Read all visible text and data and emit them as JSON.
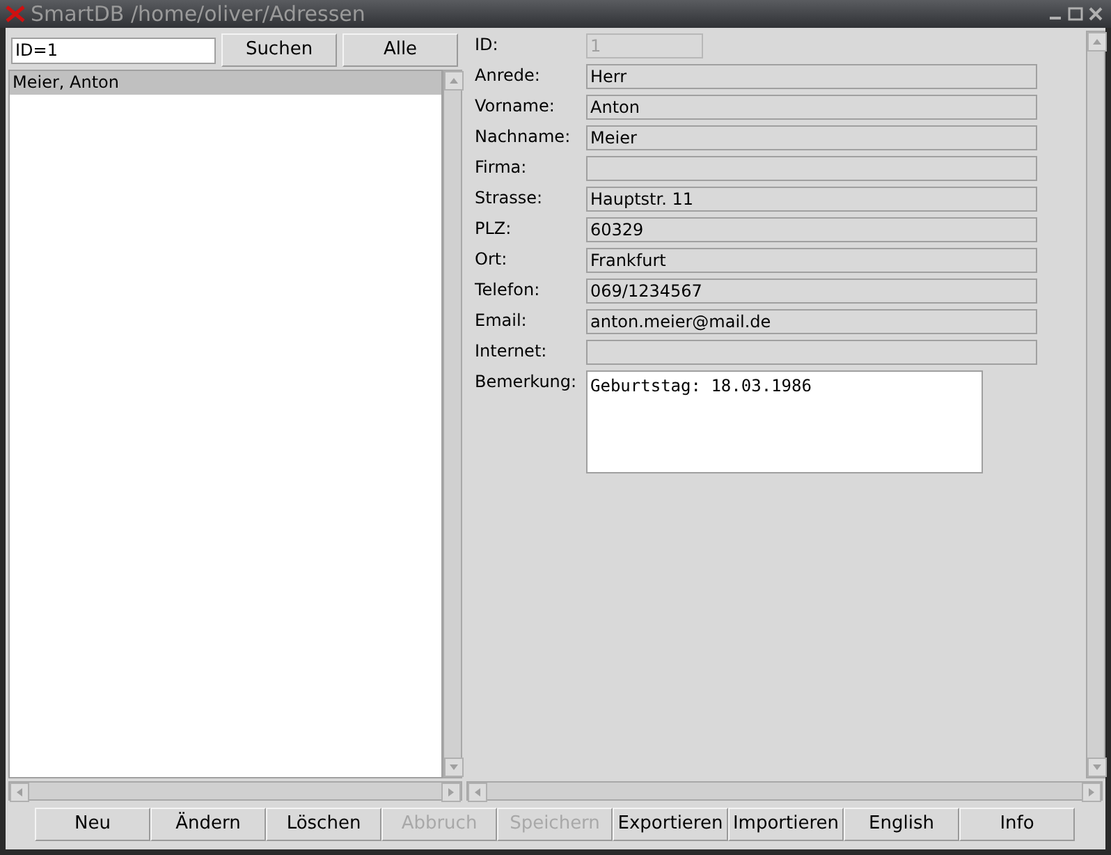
{
  "window": {
    "title": "SmartDB /home/oliver/Adressen"
  },
  "search": {
    "value": "ID=1",
    "buttons": [
      "Suchen",
      "Alle"
    ]
  },
  "list": {
    "items": [
      {
        "label": "Meier, Anton",
        "selected": true
      }
    ]
  },
  "form": {
    "fields": [
      {
        "label": "ID:",
        "value": "1",
        "kind": "short",
        "disabled": true
      },
      {
        "label": "Anrede:",
        "value": "Herr",
        "kind": "line",
        "disabled": false
      },
      {
        "label": "Vorname:",
        "value": "Anton",
        "kind": "line",
        "disabled": false
      },
      {
        "label": "Nachname:",
        "value": "Meier",
        "kind": "line",
        "disabled": false
      },
      {
        "label": "Firma:",
        "kind": "line",
        "disabled": false
      },
      {
        "label": "Strasse:",
        "value": "Hauptstr. 11",
        "kind": "line",
        "disabled": false
      },
      {
        "label": "PLZ:",
        "value": "60329",
        "kind": "line",
        "disabled": false
      },
      {
        "label": "Ort:",
        "value": "Frankfurt",
        "kind": "line",
        "disabled": false
      },
      {
        "label": "Telefon:",
        "value": "069/1234567",
        "kind": "line",
        "disabled": false
      },
      {
        "label": "Email:",
        "value": "anton.meier@mail.de",
        "kind": "line",
        "disabled": false
      },
      {
        "label": "Internet:",
        "kind": "line",
        "disabled": false
      },
      {
        "label": "Bemerkung:",
        "value": "Geburtstag: 18.03.1986",
        "kind": "memo",
        "disabled": false
      }
    ]
  },
  "buttons": [
    {
      "label": "Neu",
      "disabled": false
    },
    {
      "label": "Ändern",
      "disabled": false
    },
    {
      "label": "Löschen",
      "disabled": false
    },
    {
      "label": "Abbruch",
      "disabled": true
    },
    {
      "label": "Speichern",
      "disabled": true
    },
    {
      "label": "Exportieren",
      "disabled": false
    },
    {
      "label": "Importieren",
      "disabled": false
    },
    {
      "label": "English",
      "disabled": false
    },
    {
      "label": "Info",
      "disabled": false
    }
  ]
}
